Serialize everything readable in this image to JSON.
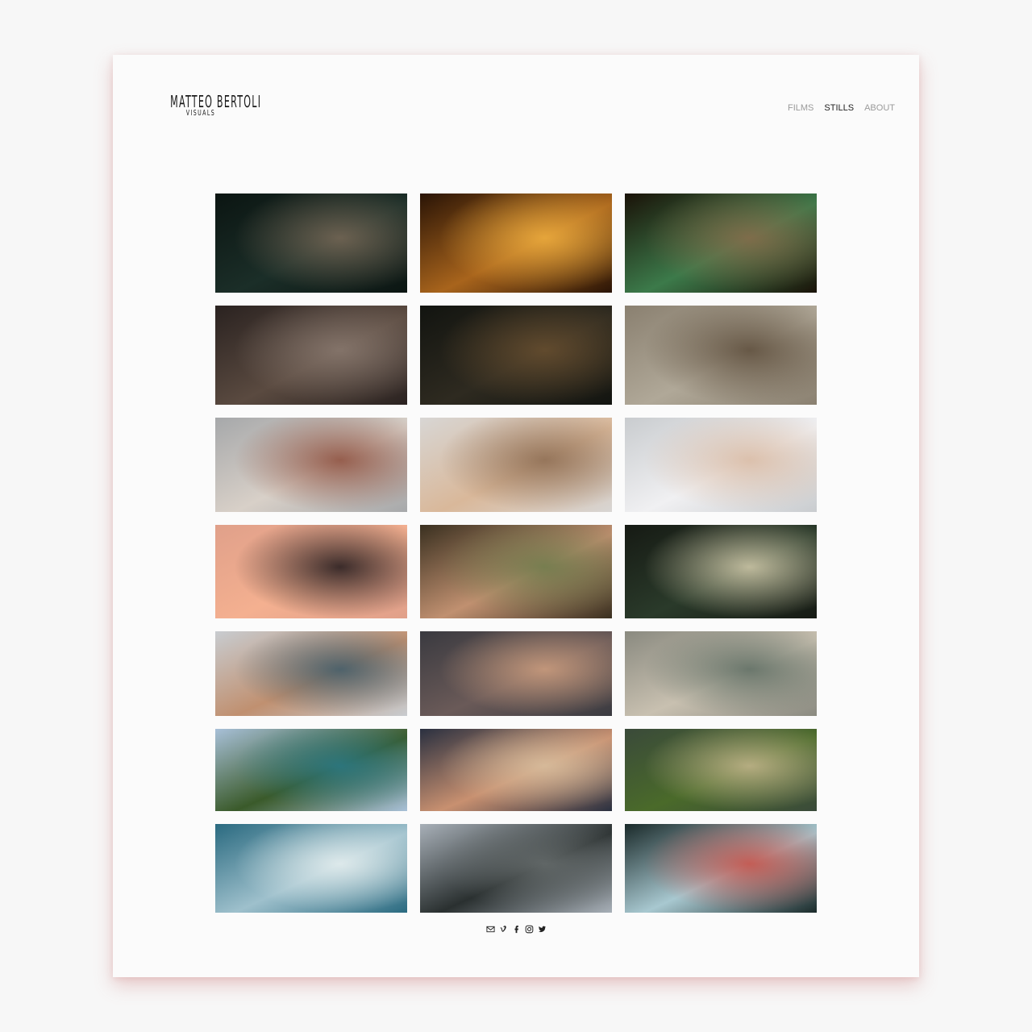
{
  "logo": {
    "main": "MATTEO BERTOLI",
    "sub": "VISUALS"
  },
  "nav": [
    {
      "label": "FILMS",
      "active": false
    },
    {
      "label": "STILLS",
      "active": true
    },
    {
      "label": "ABOUT",
      "active": false
    }
  ],
  "stills": [
    {
      "name": "still-man-shaving",
      "colors": [
        "#0b1512",
        "#1b2e28",
        "#7a6a58"
      ]
    },
    {
      "name": "still-candle-bowl",
      "colors": [
        "#2a1406",
        "#a8641c",
        "#f0b040"
      ]
    },
    {
      "name": "still-couple-green-hair",
      "colors": [
        "#1a1208",
        "#3c7a4a",
        "#8a6a4a"
      ]
    },
    {
      "name": "still-bokeh-figure",
      "colors": [
        "#2a2220",
        "#5a4a40",
        "#8a7a70"
      ]
    },
    {
      "name": "still-man-writing",
      "colors": [
        "#121410",
        "#2e2a20",
        "#6a5030"
      ]
    },
    {
      "name": "still-hat-man-blur",
      "colors": [
        "#8a8070",
        "#b0a898",
        "#5a4a38"
      ]
    },
    {
      "name": "still-woman-bridge",
      "colors": [
        "#a6a8aa",
        "#d8d0c8",
        "#8a4a38"
      ]
    },
    {
      "name": "still-woman-portrait",
      "colors": [
        "#d8d6d4",
        "#d9b89a",
        "#8a6a50"
      ]
    },
    {
      "name": "still-woman-sleeping",
      "colors": [
        "#c9cccf",
        "#f0f0f2",
        "#d8b8a0"
      ]
    },
    {
      "name": "still-sunset-silhouettes",
      "colors": [
        "#e0a08a",
        "#f4b090",
        "#1a1418"
      ]
    },
    {
      "name": "still-man-hat-closeup",
      "colors": [
        "#3a3020",
        "#c09070",
        "#6a7a4a"
      ]
    },
    {
      "name": "still-forest-silhouette",
      "colors": [
        "#161a14",
        "#2a3a2a",
        "#d8d0b0"
      ]
    },
    {
      "name": "still-coastal-town",
      "colors": [
        "#c8ccd0",
        "#c09070",
        "#3a5a6a"
      ]
    },
    {
      "name": "still-couple-kiss",
      "colors": [
        "#3a3a40",
        "#6a5a58",
        "#d0a080"
      ]
    },
    {
      "name": "still-old-man-glasses",
      "colors": [
        "#8a8a80",
        "#c8c0b0",
        "#5a6a60"
      ]
    },
    {
      "name": "still-palm-coast",
      "colors": [
        "#a8c0d8",
        "#3a5a2a",
        "#2a7a8a"
      ]
    },
    {
      "name": "still-couple-drink",
      "colors": [
        "#2a3040",
        "#c89070",
        "#d8c0a0"
      ]
    },
    {
      "name": "still-green-valley",
      "colors": [
        "#3a4a3a",
        "#4a6a2a",
        "#c8b890"
      ]
    },
    {
      "name": "still-blue-clouds",
      "colors": [
        "#2a6a80",
        "#9ec0cc",
        "#e8f0f0"
      ]
    },
    {
      "name": "still-london-eye",
      "colors": [
        "#a8b0b8",
        "#2a3030",
        "#6a7070"
      ]
    },
    {
      "name": "still-subway-window",
      "colors": [
        "#1a2a2a",
        "#a8c8d0",
        "#c84a40"
      ]
    }
  ],
  "social": [
    {
      "icon": "mail-icon",
      "label": "Email"
    },
    {
      "icon": "vimeo-icon",
      "label": "Vimeo"
    },
    {
      "icon": "facebook-icon",
      "label": "Facebook"
    },
    {
      "icon": "instagram-icon",
      "label": "Instagram"
    },
    {
      "icon": "twitter-icon",
      "label": "Twitter"
    }
  ]
}
